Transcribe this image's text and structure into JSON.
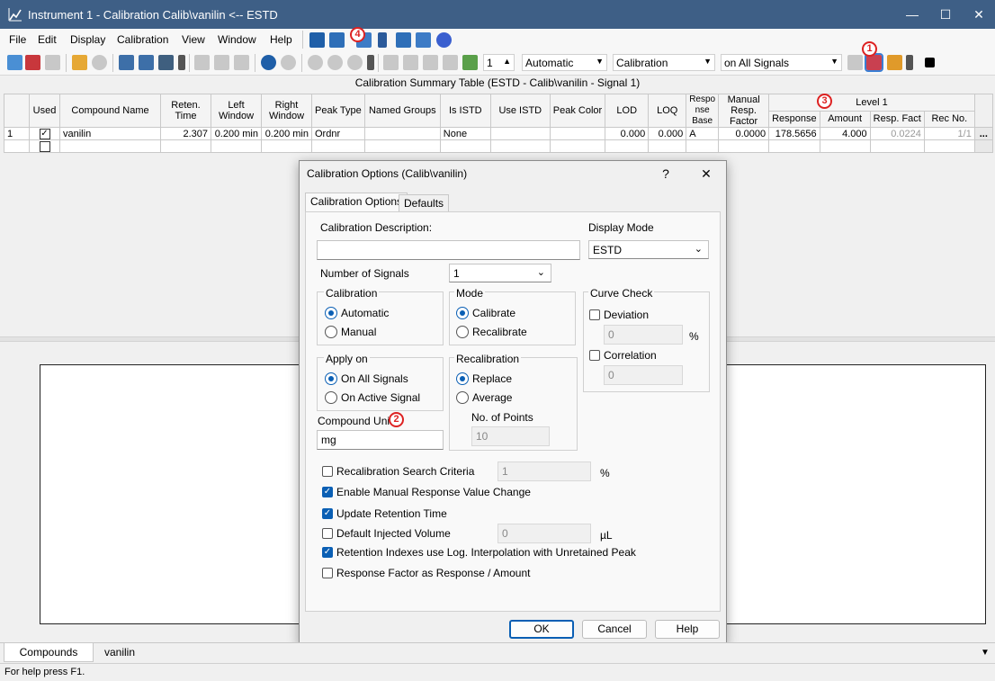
{
  "window": {
    "title": "Instrument 1 - Calibration Calib\\vanilin <-- ESTD",
    "minimize_icon": "minimize-icon",
    "maximize_icon": "maximize-icon",
    "close_icon": "close-icon"
  },
  "menu": [
    "File",
    "Edit",
    "Display",
    "Calibration",
    "View",
    "Window",
    "Help"
  ],
  "toolbar": {
    "level_value": "1",
    "mode_combo": "Automatic",
    "type_combo": "Calibration",
    "signals_combo": "on All Signals"
  },
  "table": {
    "title": "Calibration Summary Table (ESTD - Calib\\vanilin - Signal 1)",
    "headers": {
      "used": "Used",
      "compound": "Compound Name",
      "reten": "Reten. Time",
      "left": "Left Window",
      "right": "Right Window",
      "peak_type": "Peak Type",
      "named_groups": "Named Groups",
      "is_istd": "Is ISTD",
      "use_istd": "Use ISTD",
      "peak_color": "Peak Color",
      "lod": "LOD",
      "loq": "LOQ",
      "resp_base": "Respo nse Base",
      "manual_resp": "Manual Resp. Factor",
      "level": "Level 1",
      "response": "Response",
      "amount": "Amount",
      "resp_fact": "Resp. Fact",
      "rec_no": "Rec No."
    },
    "row": {
      "num": "1",
      "compound": "vanilin",
      "reten": "2.307",
      "left": "0.200 min",
      "right": "0.200 min",
      "peak_type": "Ordnr",
      "is_istd": "None",
      "lod": "0.000",
      "loq": "0.000",
      "resp_base": "A",
      "manual_resp": "0.0000",
      "response": "178.5656",
      "amount": "4.000",
      "resp_fact": "0.0224",
      "rec_no": "1/1",
      "more": "..."
    }
  },
  "dialog": {
    "title": "Calibration Options (Calib\\vanilin)",
    "help": "?",
    "close": "✕",
    "tabs": [
      "Calibration Options",
      "Defaults"
    ],
    "calibration_description_label": "Calibration Description:",
    "calibration_description_value": "",
    "display_mode_label": "Display Mode",
    "display_mode_value": "ESTD",
    "number_of_signals_label": "Number of Signals",
    "number_of_signals_value": "1",
    "calibration_group": "Calibration",
    "calibration_automatic": "Automatic",
    "calibration_manual": "Manual",
    "mode_group": "Mode",
    "mode_calibrate": "Calibrate",
    "mode_recalibrate": "Recalibrate",
    "curve_check_group": "Curve Check",
    "deviation_label": "Deviation",
    "deviation_value": "0",
    "percent": "%",
    "correlation_label": "Correlation",
    "correlation_value": "0",
    "apply_on_group": "Apply on",
    "apply_all": "On All Signals",
    "apply_active": "On Active Signal",
    "recalibration_group": "Recalibration",
    "recal_replace": "Replace",
    "recal_average": "Average",
    "no_of_points_label": "No. of Points",
    "no_of_points_value": "10",
    "compound_units_label": "Compound Units",
    "compound_units_value": "mg",
    "recal_search_label": "Recalibration Search Criteria",
    "recal_search_value": "1",
    "enable_manual_label": "Enable Manual Response Value Change",
    "update_rt_label": "Update Retention Time",
    "default_inj_label": "Default Injected Volume",
    "default_inj_value": "0",
    "unit_ul": "µL",
    "retention_indexes_label": "Retention Indexes use Log. Interpolation with Unretained Peak",
    "response_factor_label": "Response Factor as Response / Amount",
    "ok": "OK",
    "cancel": "Cancel",
    "help_button": "Help"
  },
  "badges": {
    "b1": "1",
    "b2": "2",
    "b3": "3",
    "b4": "4"
  },
  "bottom_tabs": [
    "Compounds",
    "vanilin"
  ],
  "status": "For help press F1.",
  "colors": {
    "titlebar": "#3e5f86",
    "accent": "#0a5fb4",
    "badge": "#dd2222"
  }
}
